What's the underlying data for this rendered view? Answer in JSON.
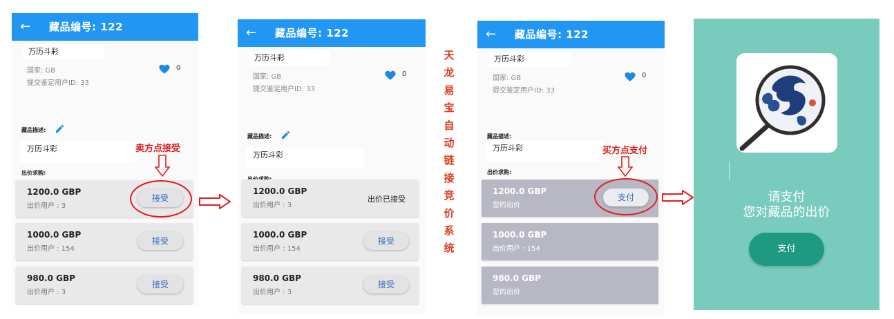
{
  "screens": [
    {
      "title": "藏品编号: 122",
      "item_name": "万历斗彩",
      "country": "国家: GB",
      "submitter": "提交鉴定用户ID: 33",
      "likes": "0",
      "desc_label": "藏品描述:",
      "desc_text": "万历斗彩",
      "offers_label": "出价求购:",
      "offers": [
        {
          "price": "1200.0 GBP",
          "user": "出价用户 : 3",
          "action": "接受"
        },
        {
          "price": "1000.0 GBP",
          "user": "出价用户 : 154",
          "action": "接受"
        },
        {
          "price": "980.0 GBP",
          "user": "出价用户 : 3",
          "action": "接受"
        }
      ]
    },
    {
      "title": "藏品编号: 122",
      "item_name": "万历斗彩",
      "country": "国家: GB",
      "submitter": "提交鉴定用户ID: 33",
      "likes": "0",
      "desc_label": "藏品描述:",
      "desc_text": "万历斗彩",
      "offers_label": "出价求购:",
      "offers": [
        {
          "price": "1200.0 GBP",
          "user": "出价用户 : 3",
          "status": "出价已接受"
        },
        {
          "price": "1000.0 GBP",
          "user": "出价用户 : 154",
          "action": "接受"
        },
        {
          "price": "980.0 GBP",
          "user": "出价用户 : 3",
          "action": "接受"
        }
      ]
    },
    {
      "title": "藏品编号: 122",
      "item_name": "万历斗彩",
      "country": "国家: GB",
      "submitter": "提交鉴定用户ID: 33",
      "likes": "0",
      "desc_label": "藏品描述:",
      "desc_text": "万历斗彩",
      "offers_label": "出价求购:",
      "offers": [
        {
          "price": "1200.0 GBP",
          "user": "您的出价",
          "action": "支付"
        },
        {
          "price": "1000.0 GBP",
          "user": "出价用户 : 154"
        },
        {
          "price": "980.0 GBP",
          "user": "您的出价"
        }
      ]
    }
  ],
  "payment": {
    "line1": "请支付",
    "line2": "您对藏品的出价",
    "button": "支付"
  },
  "annotations": {
    "seller_note": "卖方点接受",
    "buyer_note": "买方点支付",
    "vertical_caption": "天龙易宝自动链接竞价系统"
  },
  "colors": {
    "appbar": "#2196f3",
    "payment_bg": "#79ccbd",
    "pay_button": "#1f9a82",
    "annotation_red": "#e21d1d"
  },
  "icons": [
    "back-arrow-icon",
    "heart-icon",
    "edit-pencil-icon",
    "magnifier-dragon-logo"
  ]
}
